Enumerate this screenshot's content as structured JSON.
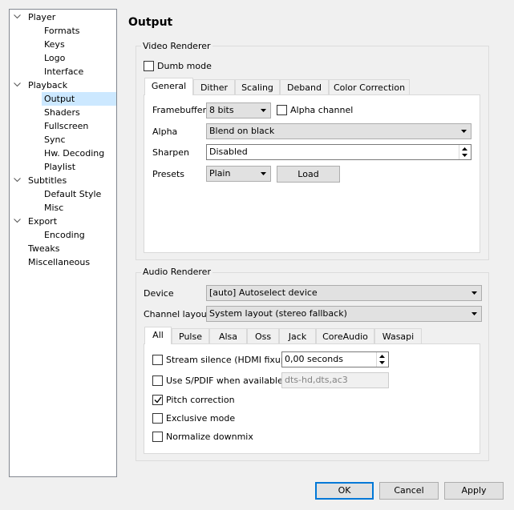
{
  "tree": {
    "items": [
      {
        "label": "Player",
        "expanded": true
      },
      {
        "label": "Formats"
      },
      {
        "label": "Keys"
      },
      {
        "label": "Logo"
      },
      {
        "label": "Interface"
      },
      {
        "label": "Playback",
        "expanded": true
      },
      {
        "label": "Output",
        "selected": true
      },
      {
        "label": "Shaders"
      },
      {
        "label": "Fullscreen"
      },
      {
        "label": "Sync"
      },
      {
        "label": "Hw. Decoding"
      },
      {
        "label": "Playlist"
      },
      {
        "label": "Subtitles",
        "expanded": true
      },
      {
        "label": "Default Style"
      },
      {
        "label": "Misc"
      },
      {
        "label": "Export",
        "expanded": true
      },
      {
        "label": "Encoding"
      },
      {
        "label": "Tweaks"
      },
      {
        "label": "Miscellaneous"
      }
    ]
  },
  "page": {
    "title": "Output"
  },
  "video": {
    "group_label": "Video Renderer",
    "dumb_mode": {
      "label": "Dumb mode",
      "checked": false
    },
    "tabs": [
      "General",
      "Dither",
      "Scaling",
      "Deband",
      "Color Correction"
    ],
    "active_tab": "General",
    "framebuffer": {
      "label": "Framebuffer",
      "value": "8 bits"
    },
    "alpha_channel": {
      "label": "Alpha channel",
      "checked": false
    },
    "alpha": {
      "label": "Alpha",
      "value": "Blend on black"
    },
    "sharpen": {
      "label": "Sharpen",
      "value": "Disabled"
    },
    "presets": {
      "label": "Presets",
      "value": "Plain",
      "load_label": "Load"
    }
  },
  "audio": {
    "group_label": "Audio Renderer",
    "device": {
      "label": "Device",
      "value": "[auto] Autoselect device"
    },
    "channel_layout": {
      "label": "Channel layout",
      "value": "System layout (stereo fallback)"
    },
    "tabs": [
      "All",
      "Pulse",
      "Alsa",
      "Oss",
      "Jack",
      "CoreAudio",
      "Wasapi"
    ],
    "active_tab": "All",
    "stream_silence": {
      "label": "Stream silence (HDMI fixup)",
      "checked": false,
      "value": "0,00 seconds"
    },
    "spdif": {
      "label": "Use S/PDIF when available",
      "checked": false,
      "value": "dts-hd,dts,ac3"
    },
    "pitch": {
      "label": "Pitch correction",
      "checked": true
    },
    "exclusive": {
      "label": "Exclusive mode",
      "checked": false
    },
    "normalize": {
      "label": "Normalize downmix",
      "checked": false
    }
  },
  "buttons": {
    "ok": "OK",
    "cancel": "Cancel",
    "apply": "Apply"
  },
  "colors": {
    "accent": "#0078d7",
    "selection": "#cce8ff"
  }
}
